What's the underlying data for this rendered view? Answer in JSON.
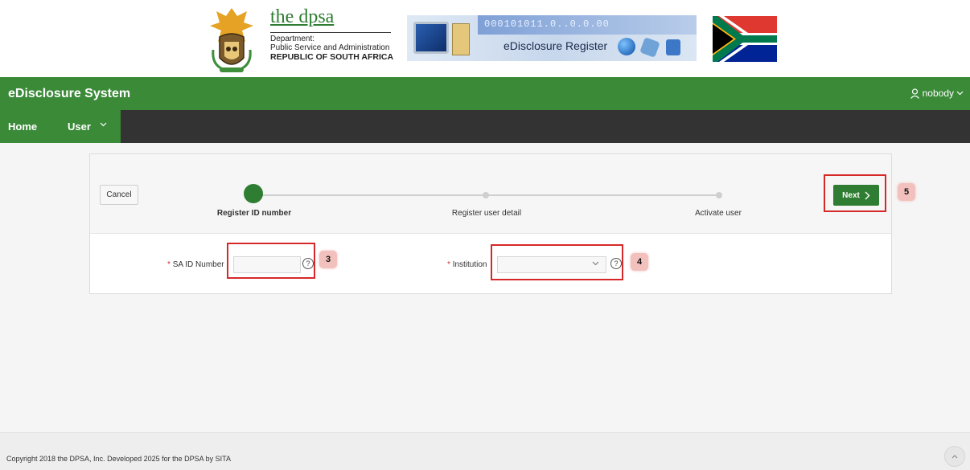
{
  "banner": {
    "org_title": "the dpsa",
    "org_line1": "Department:",
    "org_line2": "Public Service and Administration",
    "org_line3": "REPUBLIC OF SOUTH AFRICA",
    "register_banner_binary": "000101011.0..0.0.00",
    "register_banner_title": "eDisclosure Register",
    "crest_icon": "coat-of-arms-icon",
    "flag_icon": "south-africa-flag-icon"
  },
  "appbar": {
    "title": "eDisclosure System",
    "user_name": "nobody",
    "user_icon": "person-icon",
    "color": "#3a8a38"
  },
  "nav": {
    "items": [
      {
        "label": "Home"
      },
      {
        "label": "User"
      }
    ],
    "bar_color": "#333333"
  },
  "wizard": {
    "cancel_label": "Cancel",
    "next_label": "Next",
    "steps": [
      {
        "label": "Register ID number",
        "active": true
      },
      {
        "label": "Register user detail",
        "active": false
      },
      {
        "label": "Activate user",
        "active": false
      }
    ],
    "accent": "#2f7d32"
  },
  "form": {
    "sa_id": {
      "required_mark": "*",
      "label": "SA ID Number",
      "value": "",
      "help": "?"
    },
    "institution": {
      "required_mark": "*",
      "label": "Institution",
      "selected": "",
      "help": "?"
    }
  },
  "annotations": [
    "3",
    "4",
    "5"
  ],
  "footer": {
    "copyright": "Copyright 2018 the DPSA, Inc. Developed 2025 for the DPSA by SITA"
  }
}
